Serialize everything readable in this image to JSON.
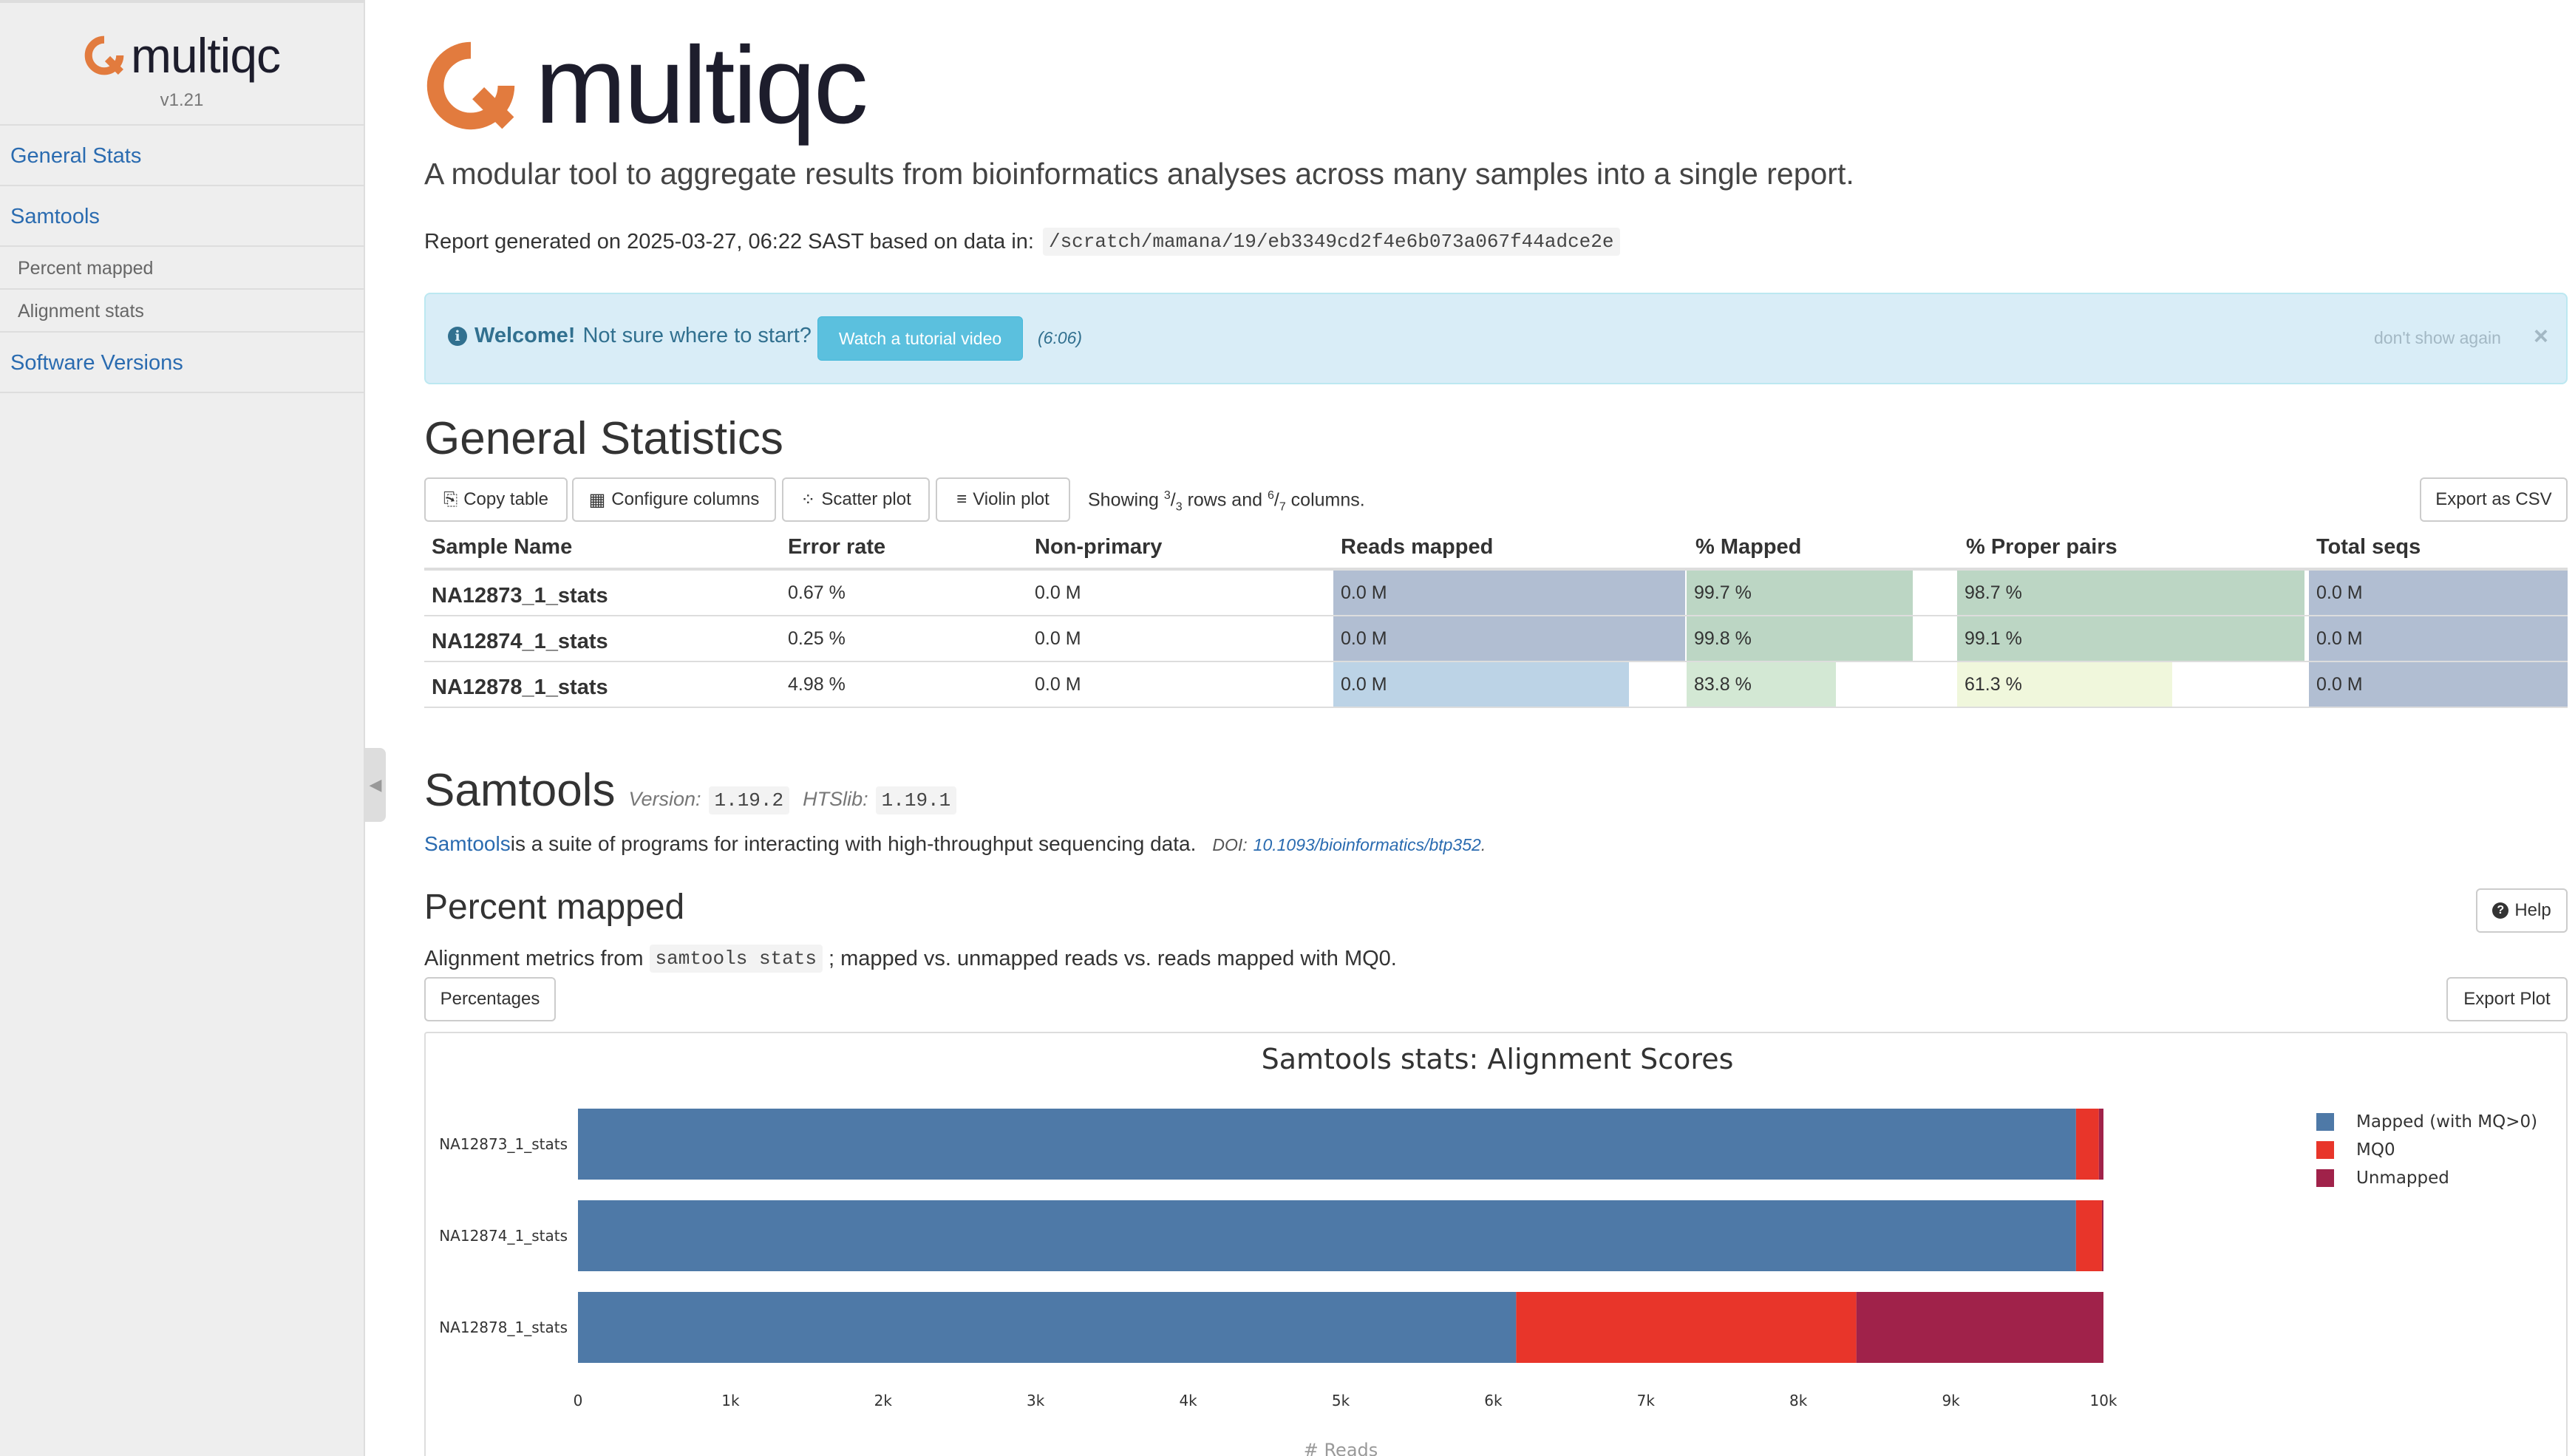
{
  "sidebar": {
    "logo_text": "multiqc",
    "version": "v1.21",
    "items": [
      {
        "label": "General Stats",
        "type": "main"
      },
      {
        "label": "Samtools",
        "type": "main"
      },
      {
        "label": "Percent mapped",
        "type": "sub"
      },
      {
        "label": "Alignment stats",
        "type": "sub"
      },
      {
        "label": "Software Versions",
        "type": "main"
      }
    ]
  },
  "header": {
    "logo_text": "multiqc",
    "tagline": "A modular tool to aggregate results from bioinformatics analyses across many samples into a single report.",
    "report_prefix": "Report generated on 2025-03-27, 06:22 SAST based on data in:",
    "report_path": "/scratch/mamana/19/eb3349cd2f4e6b073a067f44adce2e"
  },
  "welcome": {
    "bold": "Welcome!",
    "text": "Not sure where to start?",
    "button": "Watch a tutorial video",
    "duration": "(6:06)",
    "dismiss": "don't show again",
    "close": "×"
  },
  "general_stats": {
    "title": "General Statistics",
    "buttons": {
      "copy": "Copy table",
      "configure": "Configure columns",
      "scatter": "Scatter plot",
      "violin": "Violin plot",
      "export": "Export as CSV"
    },
    "showing": {
      "prefix": "Showing ",
      "rows_num": "3",
      "rows_den": "3",
      "mid": " rows and ",
      "cols_num": "6",
      "cols_den": "7",
      "suffix": " columns."
    },
    "columns": [
      "Sample Name",
      "Error rate",
      "Non-primary",
      "Reads mapped",
      "% Mapped",
      "% Proper pairs",
      "Total seqs"
    ],
    "rows": [
      {
        "sample": "NA12873_1_stats",
        "error_rate": "0.67 %",
        "non_primary": "0.0 M",
        "reads_mapped": "0.0 M",
        "pct_mapped": "99.7 %",
        "proper_pairs": "98.7 %",
        "total_seqs": "0.0 M",
        "fills": {
          "reads_mapped": 1.0,
          "pct_mapped": 1.0,
          "proper_pairs": 1.0,
          "total_seqs": 1.0
        }
      },
      {
        "sample": "NA12874_1_stats",
        "error_rate": "0.25 %",
        "non_primary": "0.0 M",
        "reads_mapped": "0.0 M",
        "pct_mapped": "99.8 %",
        "proper_pairs": "99.1 %",
        "total_seqs": "0.0 M",
        "fills": {
          "reads_mapped": 1.0,
          "pct_mapped": 1.0,
          "proper_pairs": 1.0,
          "total_seqs": 1.0
        }
      },
      {
        "sample": "NA12878_1_stats",
        "error_rate": "4.98 %",
        "non_primary": "0.0 M",
        "reads_mapped": "0.0 M",
        "pct_mapped": "83.8 %",
        "proper_pairs": "61.3 %",
        "total_seqs": "0.0 M",
        "fills": {
          "reads_mapped": 0.84,
          "pct_mapped": 0.66,
          "proper_pairs": 0.62,
          "total_seqs": 1.0
        }
      }
    ],
    "colors": {
      "reads_mapped": [
        "#b1bed2",
        "#b1bed2",
        "#bcd3e6"
      ],
      "pct_mapped": [
        "#bcd6c4",
        "#bcd6c4",
        "#d3e8d4"
      ],
      "proper_pairs": [
        "#bcd6c4",
        "#bcd6c4",
        "#f0f7dc"
      ],
      "total_seqs": [
        "#b1bed2",
        "#b1bed2",
        "#b1bed2"
      ]
    }
  },
  "samtools": {
    "title": "Samtools",
    "version_label": "Version:",
    "version": "1.19.2",
    "htslib_label": "HTSlib:",
    "htslib": "1.19.1",
    "link": "Samtools",
    "description": " is a suite of programs for interacting with high-throughput sequencing data.",
    "doi_label": "DOI:",
    "doi": "10.1093/bioinformatics/btp352",
    "doi_suffix": "."
  },
  "percent_mapped": {
    "title": "Percent mapped",
    "help": "Help",
    "desc_prefix": "Alignment metrics from ",
    "desc_code": "samtools stats",
    "desc_suffix": "; mapped vs. unmapped reads vs. reads mapped with MQ0.",
    "percentages_button": "Percentages",
    "export_button": "Export Plot"
  },
  "chart_data": {
    "type": "bar",
    "orientation": "horizontal",
    "stacked": true,
    "title": "Samtools stats: Alignment Scores",
    "xlabel": "# Reads",
    "ylabel": "",
    "xlim": [
      0,
      10000
    ],
    "xticks": [
      "0",
      "1k",
      "2k",
      "3k",
      "4k",
      "5k",
      "6k",
      "7k",
      "8k",
      "9k",
      "10k"
    ],
    "categories": [
      "NA12873_1_stats",
      "NA12874_1_stats",
      "NA12878_1_stats"
    ],
    "series": [
      {
        "name": "Mapped (with MQ>0)",
        "color": "#4e79a7",
        "values": [
          9820,
          9820,
          6150
        ]
      },
      {
        "name": "MQ0",
        "color": "#e8352a",
        "values": [
          150,
          170,
          2230
        ]
      },
      {
        "name": "Unmapped",
        "color": "#a0224a",
        "values": [
          30,
          10,
          1620
        ]
      }
    ],
    "legend": "right"
  }
}
